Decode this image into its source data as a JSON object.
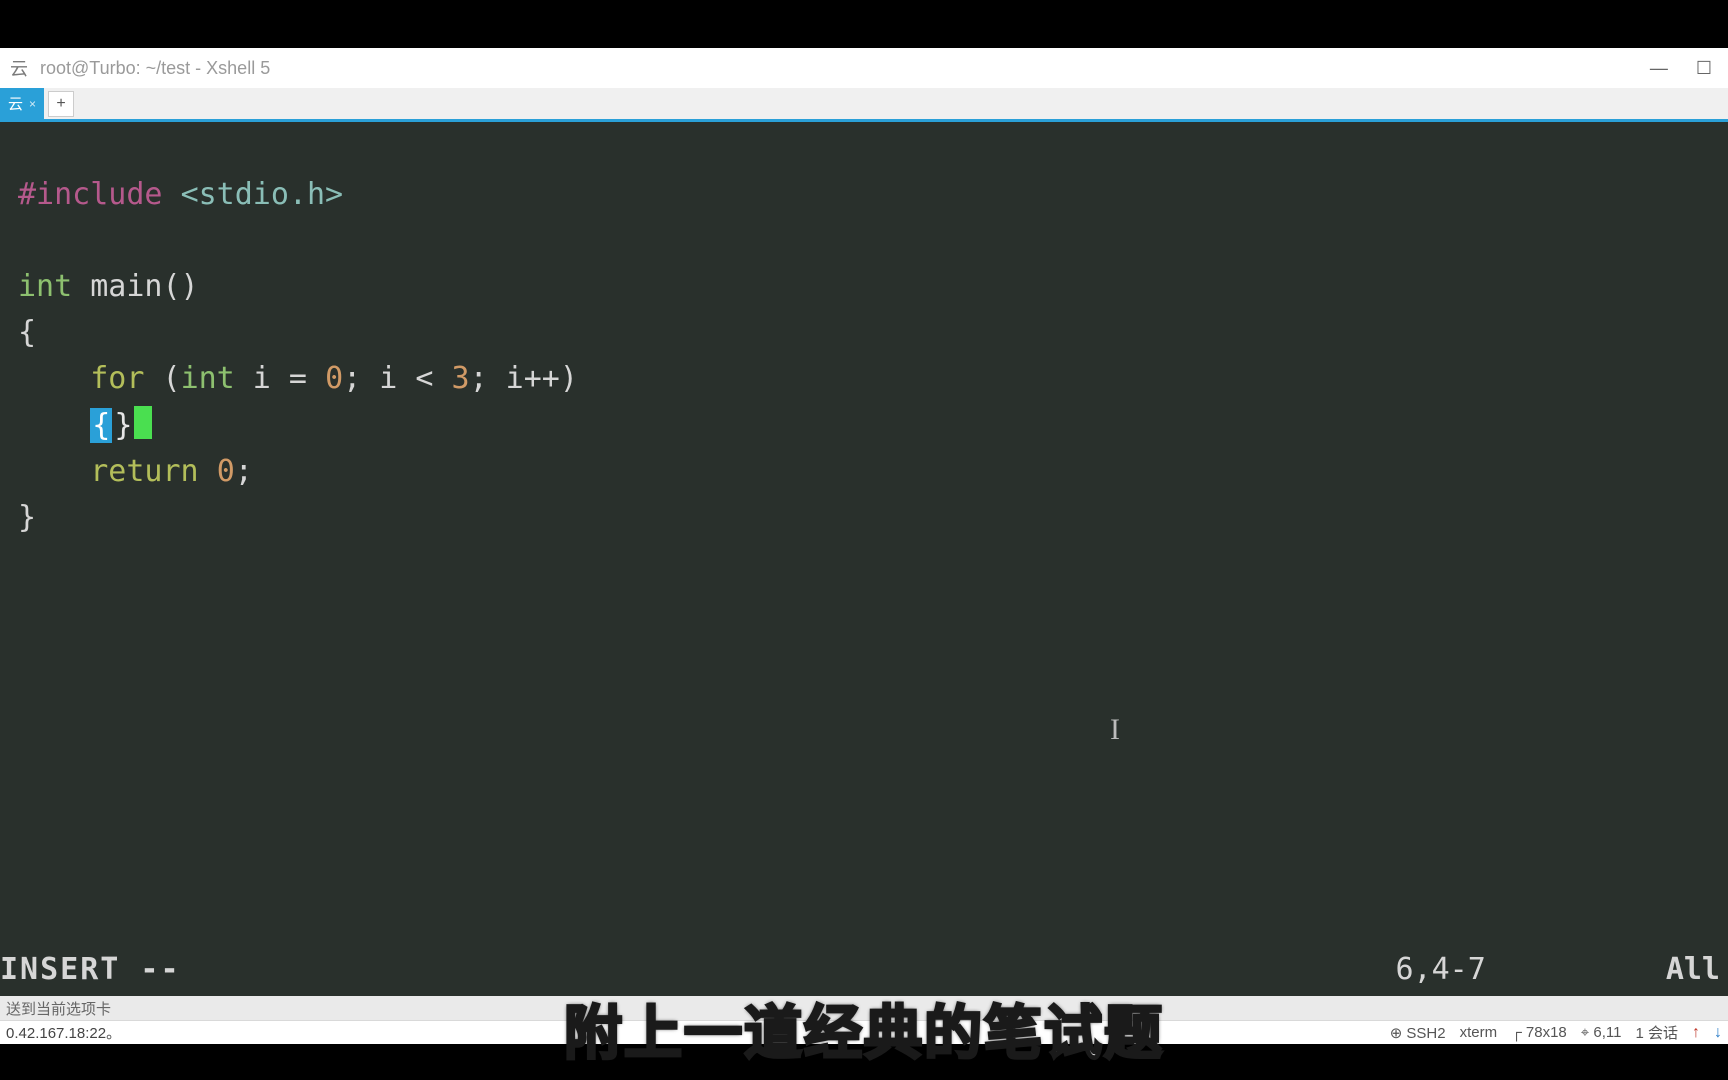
{
  "window": {
    "icon_label": "云",
    "title": "root@Turbo: ~/test - Xshell 5"
  },
  "tabs": {
    "active_label": "云",
    "add_label": "+"
  },
  "code": {
    "l1_pp": "#include",
    "l1_inc": "<stdio.h>",
    "l3_type": "int",
    "l3_fn": "main",
    "l3_parens": "()",
    "l4_brace": "{",
    "l5_indent": "    ",
    "l5_for": "for",
    "l5_open": " (",
    "l5_int": "int",
    "l5_a": " i = ",
    "l5_zero": "0",
    "l5_b": "; i < ",
    "l5_three": "3",
    "l5_c": "; i++)",
    "l6_indent": "    ",
    "l6_bo": "{",
    "l6_bc": "}",
    "l7_indent": "    ",
    "l7_ret": "return",
    "l7_sp": " ",
    "l7_zero": "0",
    "l7_semi": ";",
    "l8_brace": "}"
  },
  "vim": {
    "mode": "INSERT --",
    "position": "6,4-7",
    "scroll": "All"
  },
  "appstatus": {
    "text": "送到当前选项卡"
  },
  "conn": {
    "host": "0.42.167.18:22。",
    "ssh": "⊕ SSH2",
    "term": "xterm",
    "size": "┌ 78x18",
    "rc": "⌖ 6,11",
    "sess": "1 会话"
  },
  "subtitle": "附上一道经典的笔试题"
}
